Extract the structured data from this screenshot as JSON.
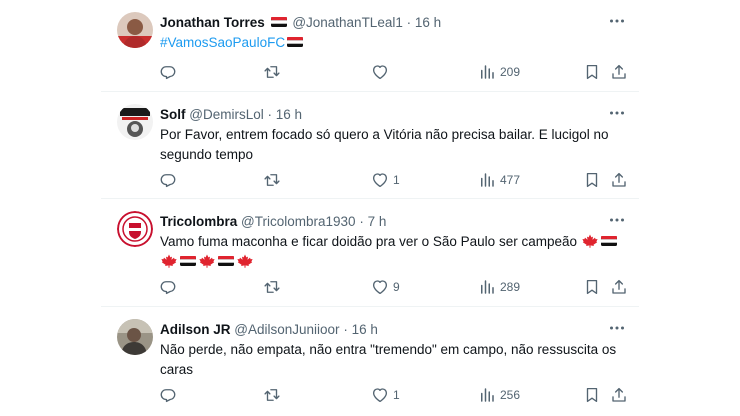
{
  "tweets": [
    {
      "name": "Jonathan Torres",
      "handle": "@JonathanTLeal1",
      "time": "16 h",
      "text": "#VamosSaoPauloFC",
      "replies": "",
      "retweets": "",
      "likes": "",
      "views": "209"
    },
    {
      "name": "Solf",
      "handle": "@DemirsLol",
      "time": "16 h",
      "text": "Por Favor, entrem focado só quero a Vitória não precisa bailar. E lucigol no segundo tempo",
      "replies": "",
      "retweets": "",
      "likes": "1",
      "views": "477"
    },
    {
      "name": "Tricolombra",
      "handle": "@Tricolombra1930",
      "time": "7 h",
      "text": "Vamo fuma maconha e ficar doidão pra ver o São Paulo ser campeão",
      "replies": "",
      "retweets": "",
      "likes": "9",
      "views": "289"
    },
    {
      "name": "Adilson JR",
      "handle": "@AdilsonJuniioor",
      "time": "16 h",
      "text": "Não perde, não empata, não entra \"tremendo\" em campo, não ressuscita os caras",
      "replies": "",
      "retweets": "",
      "likes": "1",
      "views": "256"
    }
  ],
  "separator": "·",
  "colors": {
    "text": "#0f1419",
    "secondary": "#536471",
    "link": "#1d9bf0",
    "divider": "#eff3f4",
    "flag_red": "#e0242f",
    "flag_black": "#111111"
  },
  "icons": {
    "more": "more-dots-icon",
    "reply": "reply-icon",
    "retweet": "retweet-icon",
    "like": "heart-icon",
    "views": "views-chart-icon",
    "bookmark": "bookmark-icon",
    "share": "share-icon",
    "flag": "sao-paulo-flag-icon",
    "leaf": "maple-leaf-icon"
  }
}
